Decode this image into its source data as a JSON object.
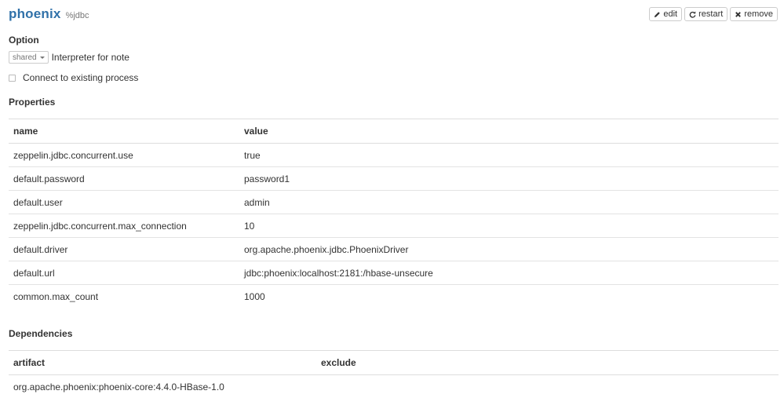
{
  "interpreter": {
    "name": "phoenix",
    "group": "%jdbc"
  },
  "actions": {
    "edit_label": "edit",
    "restart_label": "restart",
    "remove_label": "remove"
  },
  "option": {
    "title": "Option",
    "select_value": "shared",
    "select_label": "Interpreter for note",
    "checkbox_label": "Connect to existing process",
    "checkbox_checked": false
  },
  "properties": {
    "title": "Properties",
    "columns": [
      "name",
      "value"
    ],
    "rows": [
      {
        "name": "zeppelin.jdbc.concurrent.use",
        "value": "true"
      },
      {
        "name": "default.password",
        "value": "password1"
      },
      {
        "name": "default.user",
        "value": "admin"
      },
      {
        "name": "zeppelin.jdbc.concurrent.max_connection",
        "value": "10"
      },
      {
        "name": "default.driver",
        "value": "org.apache.phoenix.jdbc.PhoenixDriver"
      },
      {
        "name": "default.url",
        "value": "jdbc:phoenix:localhost:2181:/hbase-unsecure"
      },
      {
        "name": "common.max_count",
        "value": "1000"
      }
    ]
  },
  "dependencies": {
    "title": "Dependencies",
    "columns": [
      "artifact",
      "exclude"
    ],
    "rows": [
      {
        "artifact": "org.apache.phoenix:phoenix-core:4.4.0-HBase-1.0",
        "exclude": ""
      }
    ]
  },
  "colors": {
    "title_blue": "#3071a9",
    "text": "#333333",
    "muted": "#777777",
    "border": "#dddddd"
  }
}
